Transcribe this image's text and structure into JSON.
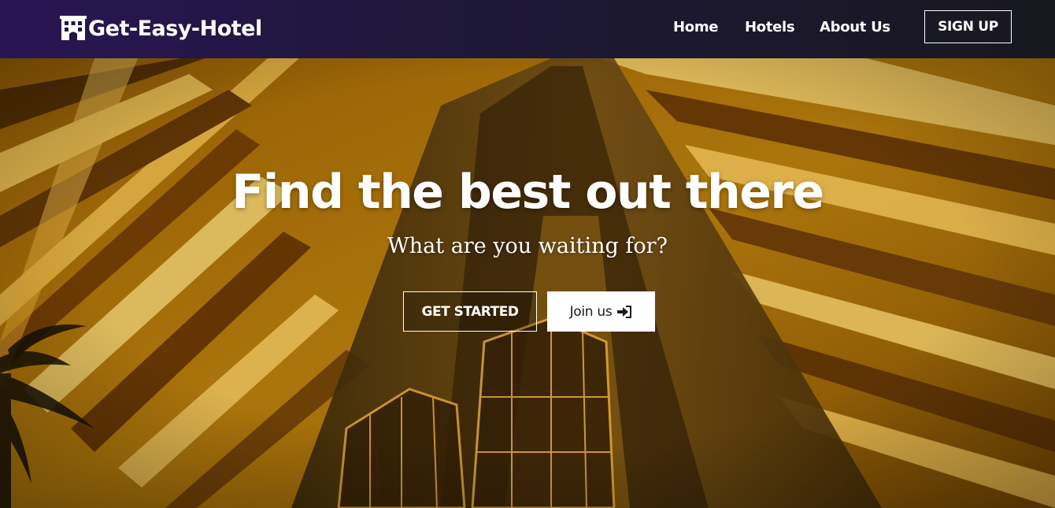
{
  "navbar": {
    "brand": "Get-Easy-Hotel",
    "brand_icon": "hotel-building-icon",
    "links": [
      "Home",
      "Hotels",
      "About Us"
    ],
    "signup_label": "SIGN UP"
  },
  "hero": {
    "title": "Find the best out there",
    "subtitle": "What are you waiting for?",
    "primary_button": "GET STARTED",
    "secondary_button": "Join us",
    "secondary_button_icon": "sign-in-icon",
    "background": "hotel-atrium-photo"
  },
  "colors": {
    "navbar_start": "#2a1554",
    "navbar_end": "#181820",
    "hero_tint": "#c98a0c",
    "text": "#ffffff"
  }
}
